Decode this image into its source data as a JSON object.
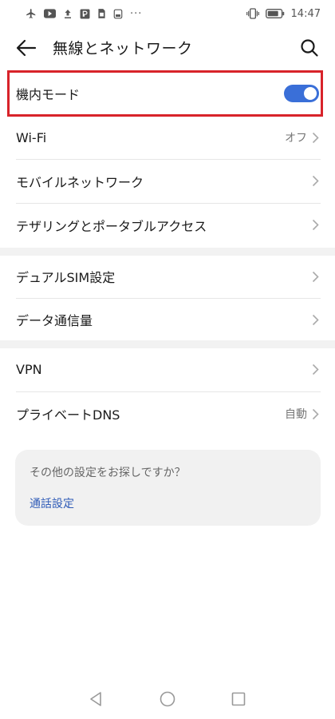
{
  "status_bar": {
    "left_icons": [
      "airplane-icon",
      "youtube-icon",
      "upload-icon",
      "parking-icon",
      "sim-icon",
      "notification-icon",
      "more-dots-icon"
    ],
    "time": "14:47",
    "right_icons": [
      "vibrate-icon",
      "battery-icon"
    ]
  },
  "header": {
    "title": "無線とネットワーク"
  },
  "rows": {
    "airplane_mode": {
      "label": "機内モード",
      "toggle_on": true
    },
    "wifi": {
      "label": "Wi-Fi",
      "value": "オフ"
    },
    "mobile_network": {
      "label": "モバイルネットワーク"
    },
    "tethering": {
      "label": "テザリングとポータブルアクセス"
    },
    "dual_sim": {
      "label": "デュアルSIM設定"
    },
    "data_usage": {
      "label": "データ通信量"
    },
    "vpn": {
      "label": "VPN"
    },
    "private_dns": {
      "label": "プライベートDNS",
      "value": "自動"
    }
  },
  "suggestion": {
    "question": "その他の設定をお探しですか？",
    "link": "通話設定"
  },
  "colors": {
    "accent": "#3a6fd8",
    "highlight": "#d8232a",
    "link": "#2f5bb7"
  }
}
